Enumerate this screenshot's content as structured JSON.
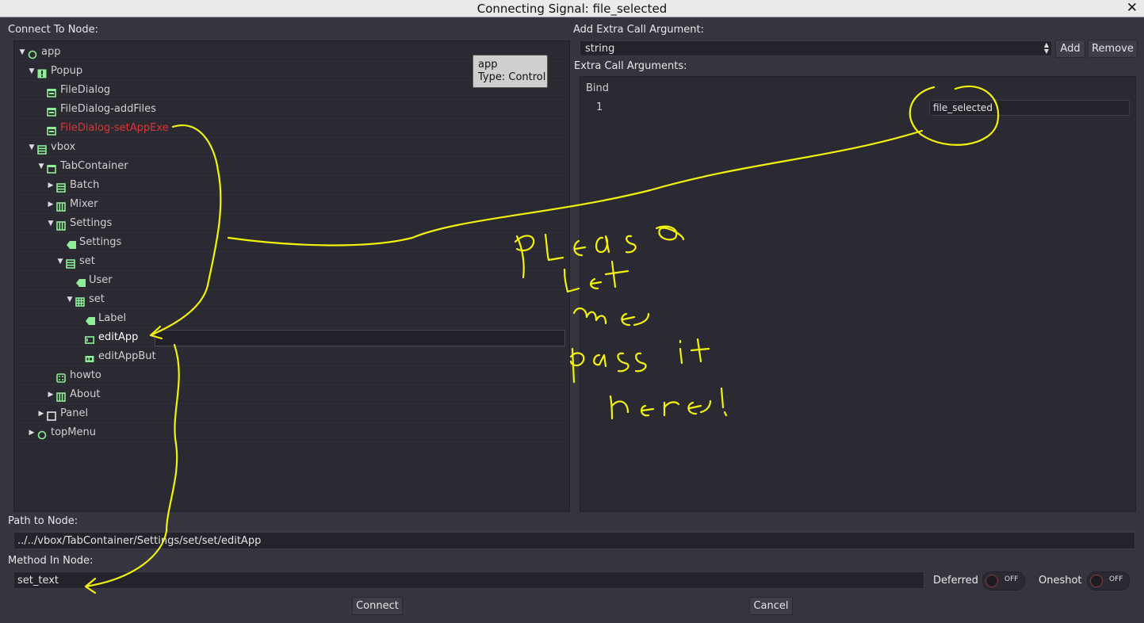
{
  "window": {
    "title": "Connecting Signal: file_selected",
    "close_glyph": "✕"
  },
  "left": {
    "connect_label": "Connect To Node:",
    "tree": [
      {
        "label": "app",
        "depth": 0,
        "arrow": "open",
        "icon": "node-circle-icon",
        "state": "normal"
      },
      {
        "label": "Popup",
        "depth": 1,
        "arrow": "open",
        "icon": "popup-warning-icon",
        "state": "normal"
      },
      {
        "label": "FileDialog",
        "depth": 2,
        "arrow": "none",
        "icon": "file-dialog-icon",
        "state": "normal"
      },
      {
        "label": "FileDialog-addFiles",
        "depth": 2,
        "arrow": "none",
        "icon": "file-dialog-icon",
        "state": "normal"
      },
      {
        "label": "FileDialog-setAppExe",
        "depth": 2,
        "arrow": "none",
        "icon": "file-dialog-icon",
        "state": "red"
      },
      {
        "label": "vbox",
        "depth": 1,
        "arrow": "open",
        "icon": "vbox-icon",
        "state": "normal"
      },
      {
        "label": "TabContainer",
        "depth": 2,
        "arrow": "open",
        "icon": "tab-container-icon",
        "state": "normal"
      },
      {
        "label": "Batch",
        "depth": 3,
        "arrow": "closed",
        "icon": "vbox-icon",
        "state": "normal"
      },
      {
        "label": "Mixer",
        "depth": 3,
        "arrow": "closed",
        "icon": "hbox-icon",
        "state": "normal"
      },
      {
        "label": "Settings",
        "depth": 3,
        "arrow": "open",
        "icon": "hbox-icon",
        "state": "normal"
      },
      {
        "label": "Settings",
        "depth": 4,
        "arrow": "none",
        "icon": "label-tag-icon",
        "state": "normal"
      },
      {
        "label": "set",
        "depth": 4,
        "arrow": "open",
        "icon": "vbox-icon",
        "state": "normal"
      },
      {
        "label": "User",
        "depth": 5,
        "arrow": "none",
        "icon": "label-tag-icon",
        "state": "normal"
      },
      {
        "label": "set",
        "depth": 5,
        "arrow": "open",
        "icon": "grid-container-icon",
        "state": "normal"
      },
      {
        "label": "Label",
        "depth": 6,
        "arrow": "none",
        "icon": "label-tag-icon",
        "state": "normal"
      },
      {
        "label": "editApp",
        "depth": 6,
        "arrow": "none",
        "icon": "line-edit-icon",
        "state": "selected"
      },
      {
        "label": "editAppBut",
        "depth": 6,
        "arrow": "none",
        "icon": "button-ok-icon",
        "state": "normal"
      },
      {
        "label": "howto",
        "depth": 3,
        "arrow": "none",
        "icon": "dice-icon",
        "state": "normal"
      },
      {
        "label": "About",
        "depth": 3,
        "arrow": "closed",
        "icon": "hbox-icon",
        "state": "normal"
      },
      {
        "label": "Panel",
        "depth": 2,
        "arrow": "closed",
        "icon": "panel-square-icon",
        "state": "normal"
      },
      {
        "label": "topMenu",
        "depth": 1,
        "arrow": "closed",
        "icon": "node-circle-icon",
        "state": "normal"
      }
    ],
    "tooltip": {
      "line1": "app",
      "line2": "Type: Control"
    }
  },
  "right": {
    "add_extra_label": "Add Extra Call Argument:",
    "type_select_value": "string",
    "add_button": "Add",
    "remove_button": "Remove",
    "extra_args_label": "Extra Call Arguments:",
    "bind_header": "Bind",
    "args": [
      {
        "index": "1",
        "value": "file_selected"
      }
    ]
  },
  "bottom": {
    "path_label": "Path to Node:",
    "path_value": "../../vbox/TabContainer/Settings/set/set/editApp",
    "method_label": "Method In Node:",
    "method_value": "set_text",
    "deferred_label": "Deferred",
    "deferred_state": "OFF",
    "oneshot_label": "Oneshot",
    "oneshot_state": "OFF",
    "connect_button": "Connect",
    "cancel_button": "Cancel"
  },
  "colors": {
    "icon_green": "#8eef97",
    "error_red": "#e03232",
    "annotation_yellow": "#f2f20a"
  }
}
